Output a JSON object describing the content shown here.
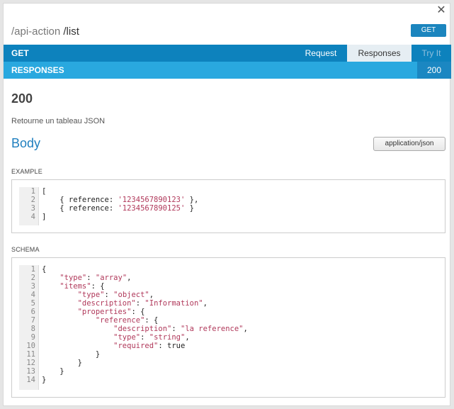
{
  "header": {
    "path_prefix": "/api-action",
    "path_strong": "/list",
    "method_badge": "GET"
  },
  "nav": {
    "method": "GET",
    "tabs": [
      "Request",
      "Responses",
      "Try It"
    ]
  },
  "subnav": {
    "title": "RESPONSES",
    "code_tab": "200"
  },
  "response": {
    "status_code": "200",
    "description": "Retourne un tableau JSON",
    "body_heading": "Body",
    "mime": "application/json"
  },
  "example": {
    "label": "EXAMPLE",
    "line_numbers": [
      "1",
      "2",
      "3",
      "4"
    ],
    "lines": [
      "[",
      "    { reference: '1234567890123' },",
      "    { reference: '1234567890125' }",
      "]"
    ]
  },
  "schema": {
    "label": "SCHEMA",
    "line_numbers": [
      "1",
      "2",
      "3",
      "4",
      "5",
      "6",
      "7",
      "8",
      "9",
      "10",
      "11",
      "12",
      "13",
      "14"
    ],
    "lines": [
      "{",
      "    \"type\": \"array\",",
      "    \"items\": {",
      "        \"type\": \"object\",",
      "        \"description\": \"Information\",",
      "        \"properties\": {",
      "            \"reference\": {",
      "                \"description\": \"la reference\",",
      "                \"type\": \"string\",",
      "                \"required\": true",
      "            }",
      "        }",
      "    }",
      "}"
    ]
  },
  "colors": {
    "nav_bar": "#0d82bd",
    "sub_bar": "#29a8df",
    "accent_text": "#1f7fbf",
    "string_token": "#b0385a"
  }
}
